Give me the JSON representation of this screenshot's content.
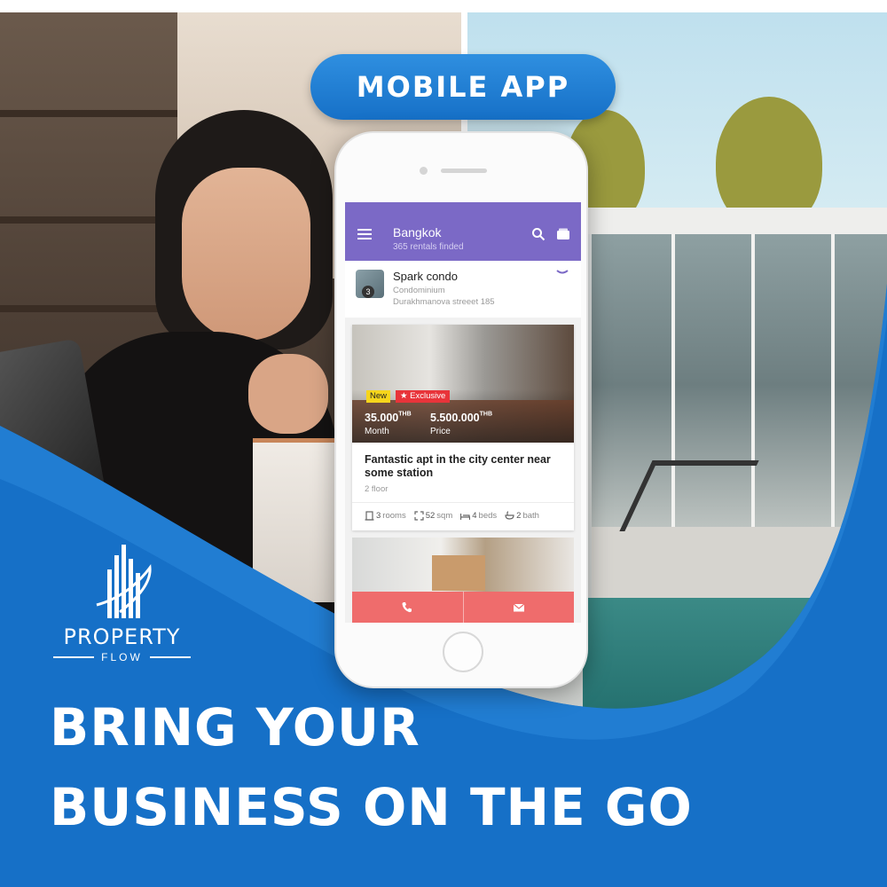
{
  "banner": {
    "pill_label": "MOBILE APP",
    "headline_line1": "BRING YOUR",
    "headline_line2": "BUSINESS ON THE GO"
  },
  "brand": {
    "name": "PROPERTY",
    "sub": "FLOW"
  },
  "app": {
    "city": "Bangkok",
    "count_text": "365 rentals finded",
    "icons": [
      "menu-icon",
      "search-icon",
      "wallet-icon"
    ],
    "accent": "#7b69c6"
  },
  "listing_header": {
    "name": "Spark condo",
    "type": "Condominium",
    "address": "Durakhmanova streeet 185",
    "badge": "3"
  },
  "card": {
    "tag_new": "New",
    "tag_exclusive": "★ Exclusive",
    "rent_value": "35.000",
    "rent_unit": "THB",
    "rent_label": "Month",
    "price_value": "5.500.000",
    "price_unit": "THB",
    "price_label": "Price",
    "title": "Fantastic apt in the city center near some station",
    "floor": "2 floor",
    "features": [
      {
        "value": "3",
        "label": "rooms",
        "icon": "door-icon"
      },
      {
        "value": "52",
        "label": "sqm",
        "icon": "area-icon"
      },
      {
        "value": "4",
        "label": "beds",
        "icon": "bed-icon"
      },
      {
        "value": "2",
        "label": "bath",
        "icon": "bath-icon"
      }
    ]
  },
  "actions": {
    "call_icon": "phone-icon",
    "mail_icon": "mail-icon",
    "color": "#ef6c6c"
  },
  "colors": {
    "brand_blue": "#1670c7",
    "tag_new": "#f6d51c",
    "tag_exclusive": "#e8343a"
  }
}
